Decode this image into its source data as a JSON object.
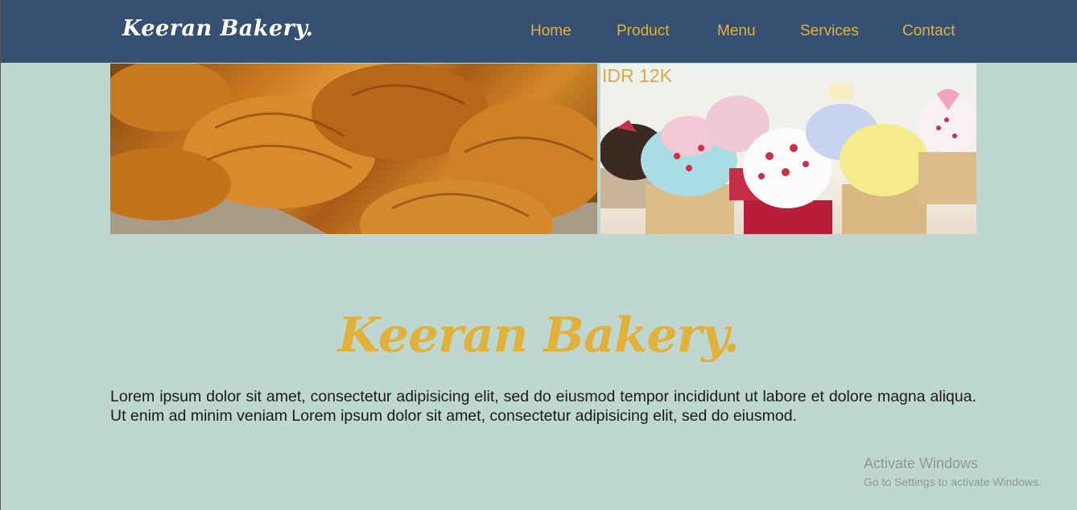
{
  "navbar": {
    "brand": "Keeran Bakery.",
    "items": [
      {
        "label": "Home"
      },
      {
        "label": "Product"
      },
      {
        "label": "Menu"
      },
      {
        "label": "Services"
      },
      {
        "label": "Contact"
      }
    ]
  },
  "gallery": {
    "price_tag": "IDR 12K"
  },
  "hero": {
    "title": "Keeran Bakery.",
    "text": "Lorem ipsum dolor sit amet, consectetur adipisicing elit, sed do eiusmod tempor incididunt ut labore et dolore magna aliqua. Ut enim ad minim veniam Lorem ipsum dolor sit amet, consectetur adipisicing elit, sed do eiusmod."
  },
  "watermark": {
    "title": "Activate Windows",
    "subtitle": "Go to Settings to activate Windows."
  },
  "colors": {
    "navbar_bg": "#355070",
    "page_bg": "#bed8d1",
    "accent": "#e2b13c"
  }
}
